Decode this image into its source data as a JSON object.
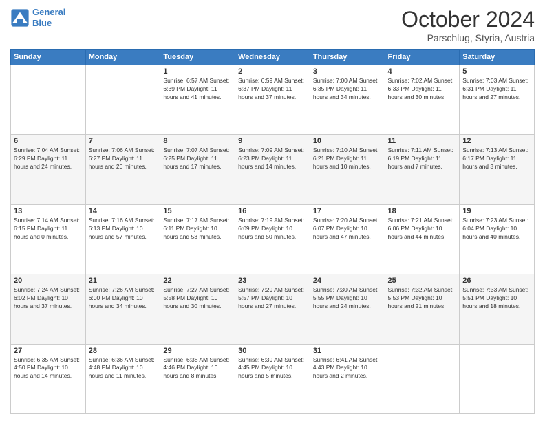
{
  "header": {
    "logo_line1": "General",
    "logo_line2": "Blue",
    "month": "October 2024",
    "location": "Parschlug, Styria, Austria"
  },
  "days_of_week": [
    "Sunday",
    "Monday",
    "Tuesday",
    "Wednesday",
    "Thursday",
    "Friday",
    "Saturday"
  ],
  "weeks": [
    [
      {
        "day": "",
        "info": ""
      },
      {
        "day": "",
        "info": ""
      },
      {
        "day": "1",
        "info": "Sunrise: 6:57 AM\nSunset: 6:39 PM\nDaylight: 11 hours and 41 minutes."
      },
      {
        "day": "2",
        "info": "Sunrise: 6:59 AM\nSunset: 6:37 PM\nDaylight: 11 hours and 37 minutes."
      },
      {
        "day": "3",
        "info": "Sunrise: 7:00 AM\nSunset: 6:35 PM\nDaylight: 11 hours and 34 minutes."
      },
      {
        "day": "4",
        "info": "Sunrise: 7:02 AM\nSunset: 6:33 PM\nDaylight: 11 hours and 30 minutes."
      },
      {
        "day": "5",
        "info": "Sunrise: 7:03 AM\nSunset: 6:31 PM\nDaylight: 11 hours and 27 minutes."
      }
    ],
    [
      {
        "day": "6",
        "info": "Sunrise: 7:04 AM\nSunset: 6:29 PM\nDaylight: 11 hours and 24 minutes."
      },
      {
        "day": "7",
        "info": "Sunrise: 7:06 AM\nSunset: 6:27 PM\nDaylight: 11 hours and 20 minutes."
      },
      {
        "day": "8",
        "info": "Sunrise: 7:07 AM\nSunset: 6:25 PM\nDaylight: 11 hours and 17 minutes."
      },
      {
        "day": "9",
        "info": "Sunrise: 7:09 AM\nSunset: 6:23 PM\nDaylight: 11 hours and 14 minutes."
      },
      {
        "day": "10",
        "info": "Sunrise: 7:10 AM\nSunset: 6:21 PM\nDaylight: 11 hours and 10 minutes."
      },
      {
        "day": "11",
        "info": "Sunrise: 7:11 AM\nSunset: 6:19 PM\nDaylight: 11 hours and 7 minutes."
      },
      {
        "day": "12",
        "info": "Sunrise: 7:13 AM\nSunset: 6:17 PM\nDaylight: 11 hours and 3 minutes."
      }
    ],
    [
      {
        "day": "13",
        "info": "Sunrise: 7:14 AM\nSunset: 6:15 PM\nDaylight: 11 hours and 0 minutes."
      },
      {
        "day": "14",
        "info": "Sunrise: 7:16 AM\nSunset: 6:13 PM\nDaylight: 10 hours and 57 minutes."
      },
      {
        "day": "15",
        "info": "Sunrise: 7:17 AM\nSunset: 6:11 PM\nDaylight: 10 hours and 53 minutes."
      },
      {
        "day": "16",
        "info": "Sunrise: 7:19 AM\nSunset: 6:09 PM\nDaylight: 10 hours and 50 minutes."
      },
      {
        "day": "17",
        "info": "Sunrise: 7:20 AM\nSunset: 6:07 PM\nDaylight: 10 hours and 47 minutes."
      },
      {
        "day": "18",
        "info": "Sunrise: 7:21 AM\nSunset: 6:06 PM\nDaylight: 10 hours and 44 minutes."
      },
      {
        "day": "19",
        "info": "Sunrise: 7:23 AM\nSunset: 6:04 PM\nDaylight: 10 hours and 40 minutes."
      }
    ],
    [
      {
        "day": "20",
        "info": "Sunrise: 7:24 AM\nSunset: 6:02 PM\nDaylight: 10 hours and 37 minutes."
      },
      {
        "day": "21",
        "info": "Sunrise: 7:26 AM\nSunset: 6:00 PM\nDaylight: 10 hours and 34 minutes."
      },
      {
        "day": "22",
        "info": "Sunrise: 7:27 AM\nSunset: 5:58 PM\nDaylight: 10 hours and 30 minutes."
      },
      {
        "day": "23",
        "info": "Sunrise: 7:29 AM\nSunset: 5:57 PM\nDaylight: 10 hours and 27 minutes."
      },
      {
        "day": "24",
        "info": "Sunrise: 7:30 AM\nSunset: 5:55 PM\nDaylight: 10 hours and 24 minutes."
      },
      {
        "day": "25",
        "info": "Sunrise: 7:32 AM\nSunset: 5:53 PM\nDaylight: 10 hours and 21 minutes."
      },
      {
        "day": "26",
        "info": "Sunrise: 7:33 AM\nSunset: 5:51 PM\nDaylight: 10 hours and 18 minutes."
      }
    ],
    [
      {
        "day": "27",
        "info": "Sunrise: 6:35 AM\nSunset: 4:50 PM\nDaylight: 10 hours and 14 minutes."
      },
      {
        "day": "28",
        "info": "Sunrise: 6:36 AM\nSunset: 4:48 PM\nDaylight: 10 hours and 11 minutes."
      },
      {
        "day": "29",
        "info": "Sunrise: 6:38 AM\nSunset: 4:46 PM\nDaylight: 10 hours and 8 minutes."
      },
      {
        "day": "30",
        "info": "Sunrise: 6:39 AM\nSunset: 4:45 PM\nDaylight: 10 hours and 5 minutes."
      },
      {
        "day": "31",
        "info": "Sunrise: 6:41 AM\nSunset: 4:43 PM\nDaylight: 10 hours and 2 minutes."
      },
      {
        "day": "",
        "info": ""
      },
      {
        "day": "",
        "info": ""
      }
    ]
  ]
}
